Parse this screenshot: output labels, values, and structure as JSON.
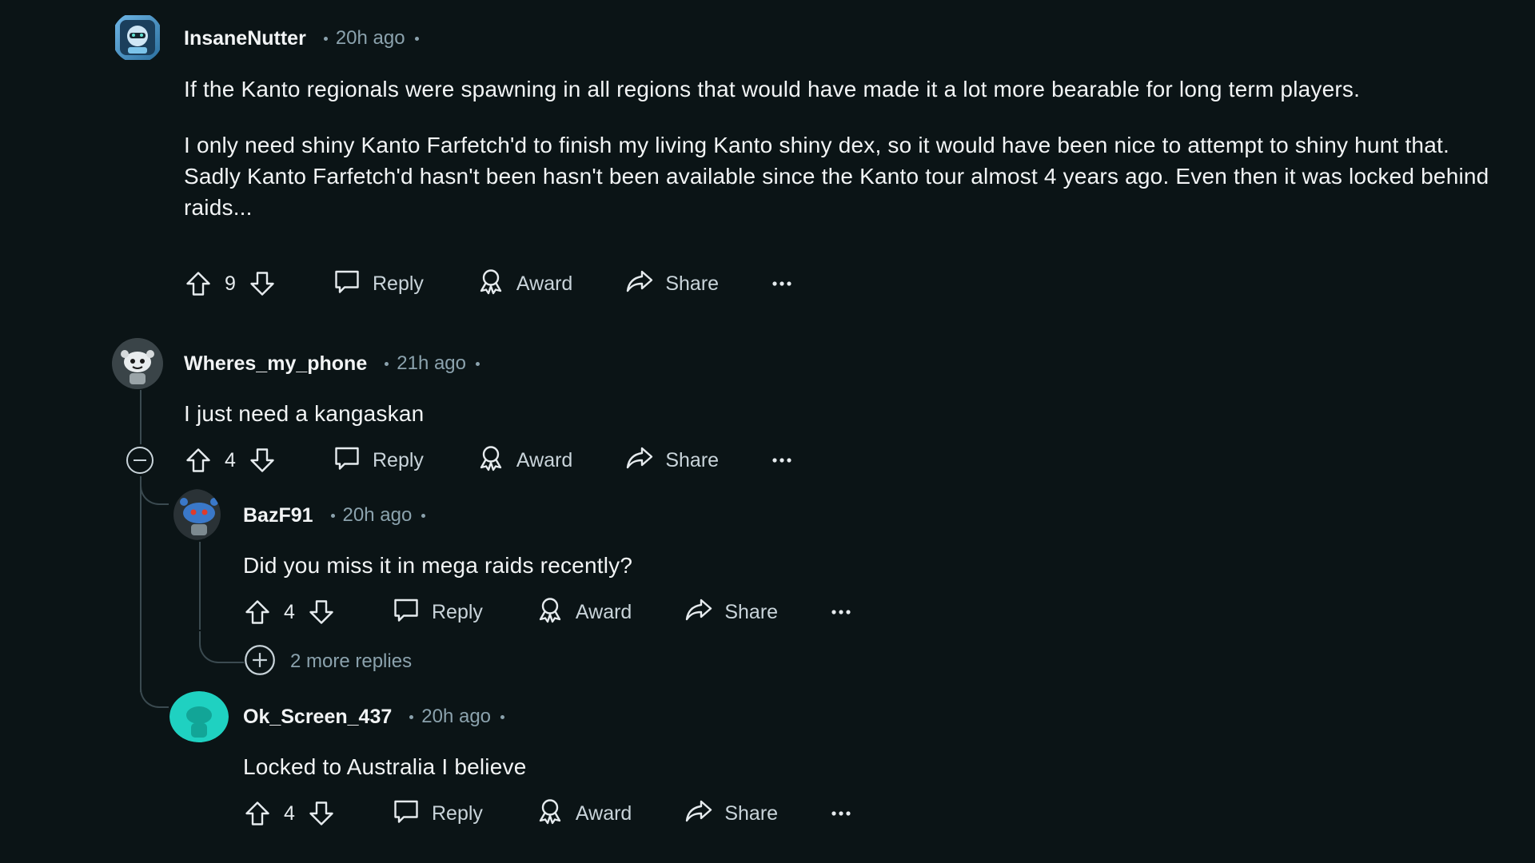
{
  "comments": [
    {
      "username": "InsaneNutter",
      "time": "20h ago",
      "paragraphs": [
        "If the Kanto regionals were spawning in all regions that would have made it a lot more bearable for long term players.",
        "I only need shiny Kanto Farfetch'd to finish my living Kanto shiny dex, so it would have been nice to attempt to shiny hunt that. Sadly Kanto Farfetch'd hasn't been hasn't been available since the Kanto tour almost 4 years ago. Even then it was locked behind raids..."
      ],
      "score": "9"
    },
    {
      "username": "Wheres_my_phone",
      "time": "21h ago",
      "paragraphs": [
        "I just need a kangaskan"
      ],
      "score": "4"
    },
    {
      "username": "BazF91",
      "time": "20h ago",
      "paragraphs": [
        "Did you miss it in mega raids recently?"
      ],
      "score": "4",
      "more_replies": "2 more replies"
    },
    {
      "username": "Ok_Screen_437",
      "time": "20h ago",
      "paragraphs": [
        "Locked to Australia I believe"
      ],
      "score": "4"
    }
  ],
  "actions": {
    "reply": "Reply",
    "award": "Award",
    "share": "Share"
  },
  "icons": {
    "upvote": "upvote-icon",
    "downvote": "downvote-icon",
    "reply": "comment-icon",
    "award": "award-icon",
    "share": "share-icon",
    "more": "more-options-icon",
    "collapse": "collapse-thread-icon",
    "expand": "expand-replies-icon"
  },
  "colors": {
    "background": "#0b1416",
    "text": "#f2f4f5",
    "muted": "#8ba2ad",
    "thread_line": "#3b4a50",
    "avatar_teal": "#1fd1c1",
    "avatar_blue": "#3a78c9"
  }
}
